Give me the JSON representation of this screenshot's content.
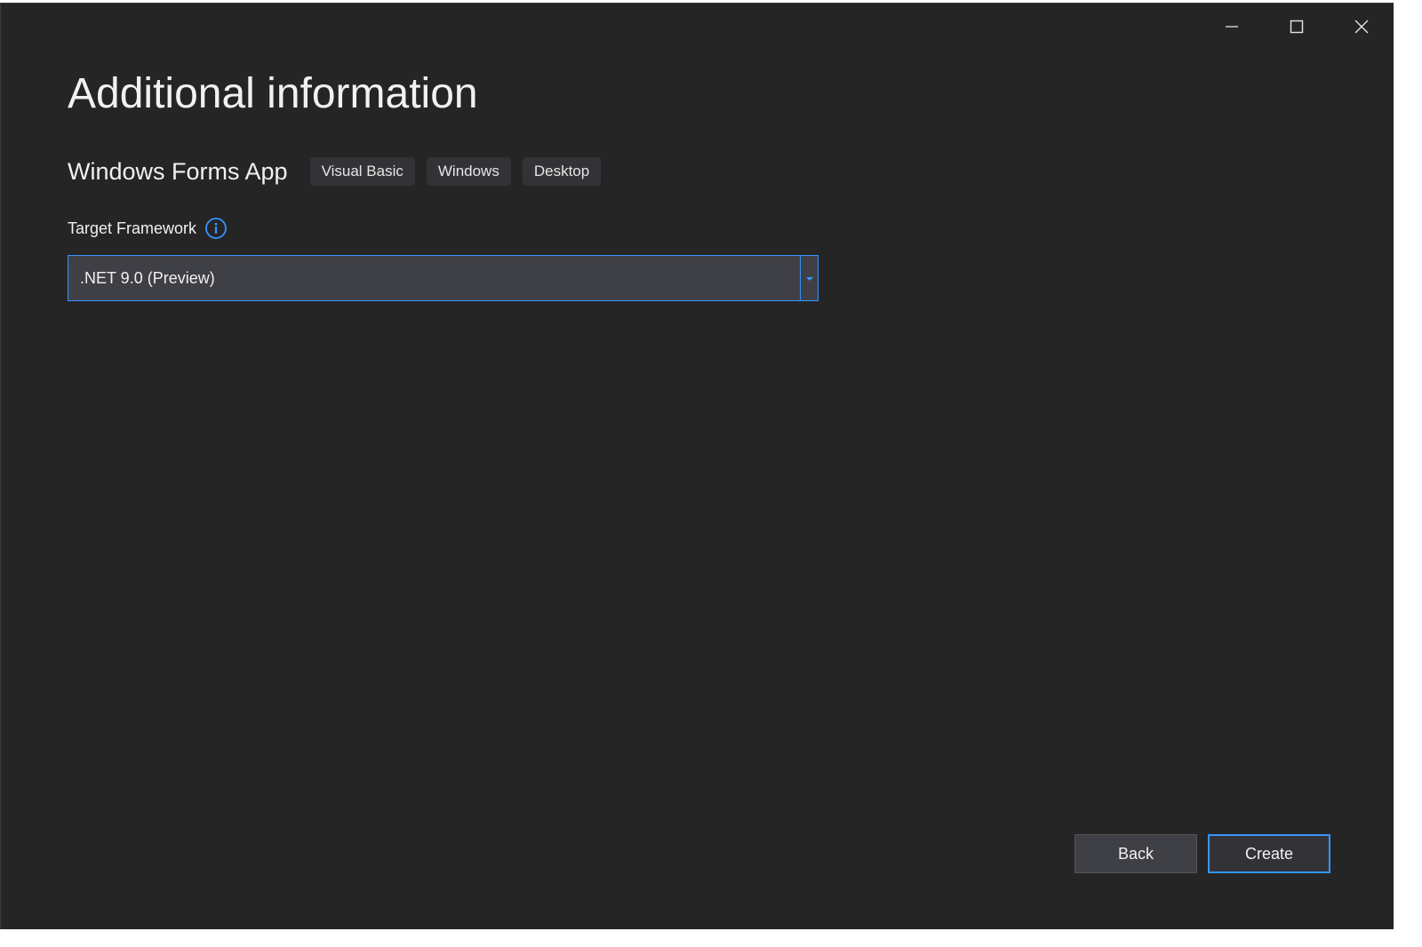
{
  "window": {
    "caption_buttons": [
      {
        "name": "minimize-button",
        "icon": "minimize-icon"
      },
      {
        "name": "maximize-button",
        "icon": "maximize-icon"
      },
      {
        "name": "close-button",
        "icon": "close-icon"
      }
    ]
  },
  "page": {
    "title": "Additional information"
  },
  "template": {
    "name": "Windows Forms App",
    "tags": [
      "Visual Basic",
      "Windows",
      "Desktop"
    ]
  },
  "framework": {
    "label": "Target Framework",
    "info_icon": "info-icon",
    "selected": ".NET 9.0 (Preview)"
  },
  "actions": {
    "back_label": "Back",
    "create_label": "Create"
  },
  "colors": {
    "background": "#252526",
    "accent": "#3794ff",
    "text": "#f1f1f1",
    "tag_bg": "#333337",
    "input_bg": "#3f3f46"
  }
}
